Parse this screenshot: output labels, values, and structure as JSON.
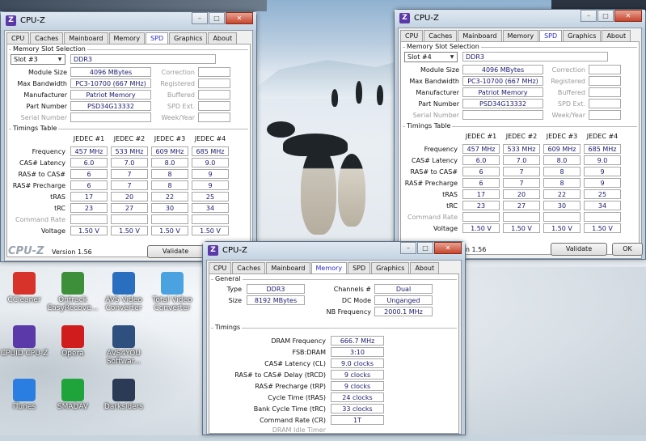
{
  "cpuz_left": {
    "title": "CPU-Z",
    "tabs": [
      "CPU",
      "Caches",
      "Mainboard",
      "Memory",
      "SPD",
      "Graphics",
      "About"
    ],
    "active_tab": "SPD",
    "memory_slot_selection": "Memory Slot Selection",
    "slot": "Slot #3",
    "type": "DDR3",
    "module_size_label": "Module Size",
    "module_size": "4096 MBytes",
    "max_bandwidth_label": "Max Bandwidth",
    "max_bandwidth": "PC3-10700 (667 MHz)",
    "manufacturer_label": "Manufacturer",
    "manufacturer": "Patriot Memory",
    "part_number_label": "Part Number",
    "part_number": "PSD34G13332",
    "serial_number_label": "Serial Number",
    "correction_label": "Correction",
    "registered_label": "Registered",
    "buffered_label": "Buffered",
    "spd_ext_label": "SPD Ext.",
    "week_year_label": "Week/Year",
    "timings_table_label": "Timings Table",
    "jedec_headers": [
      "JEDEC #1",
      "JEDEC #2",
      "JEDEC #3",
      "JEDEC #4"
    ],
    "rows": [
      {
        "label": "Frequency",
        "values": [
          "457 MHz",
          "533 MHz",
          "609 MHz",
          "685 MHz"
        ]
      },
      {
        "label": "CAS# Latency",
        "values": [
          "6.0",
          "7.0",
          "8.0",
          "9.0"
        ]
      },
      {
        "label": "RAS# to CAS#",
        "values": [
          "6",
          "7",
          "8",
          "9"
        ]
      },
      {
        "label": "RAS# Precharge",
        "values": [
          "6",
          "7",
          "8",
          "9"
        ]
      },
      {
        "label": "tRAS",
        "values": [
          "17",
          "20",
          "22",
          "25"
        ]
      },
      {
        "label": "tRC",
        "values": [
          "23",
          "27",
          "30",
          "34"
        ]
      },
      {
        "label": "Command Rate",
        "values": [
          "",
          "",
          "",
          ""
        ]
      },
      {
        "label": "Voltage",
        "values": [
          "1.50 V",
          "1.50 V",
          "1.50 V",
          "1.50 V"
        ]
      }
    ],
    "brand": "CPU-Z",
    "version": "Version 1.56",
    "validate": "Validate"
  },
  "cpuz_right": {
    "title": "CPU-Z",
    "tabs": [
      "CPU",
      "Caches",
      "Mainboard",
      "Memory",
      "SPD",
      "Graphics",
      "About"
    ],
    "active_tab": "SPD",
    "memory_slot_selection": "Memory Slot Selection",
    "slot": "Slot #4",
    "type": "DDR3",
    "module_size_label": "Module Size",
    "module_size": "4096 MBytes",
    "max_bandwidth_label": "Max Bandwidth",
    "max_bandwidth": "PC3-10700 (667 MHz)",
    "manufacturer_label": "Manufacturer",
    "manufacturer": "Patriot Memory",
    "part_number_label": "Part Number",
    "part_number": "PSD34G13332",
    "serial_number_label": "Serial Number",
    "correction_label": "Correction",
    "registered_label": "Registered",
    "buffered_label": "Buffered",
    "spd_ext_label": "SPD Ext.",
    "week_year_label": "Week/Year",
    "timings_table_label": "Timings Table",
    "jedec_headers": [
      "JEDEC #1",
      "JEDEC #2",
      "JEDEC #3",
      "JEDEC #4"
    ],
    "rows": [
      {
        "label": "Frequency",
        "values": [
          "457 MHz",
          "533 MHz",
          "609 MHz",
          "685 MHz"
        ]
      },
      {
        "label": "CAS# Latency",
        "values": [
          "6.0",
          "7.0",
          "8.0",
          "9.0"
        ]
      },
      {
        "label": "RAS# to CAS#",
        "values": [
          "6",
          "7",
          "8",
          "9"
        ]
      },
      {
        "label": "RAS# Precharge",
        "values": [
          "6",
          "7",
          "8",
          "9"
        ]
      },
      {
        "label": "tRAS",
        "values": [
          "17",
          "20",
          "22",
          "25"
        ]
      },
      {
        "label": "tRC",
        "values": [
          "23",
          "27",
          "30",
          "34"
        ]
      },
      {
        "label": "Command Rate",
        "values": [
          "",
          "",
          "",
          ""
        ]
      },
      {
        "label": "Voltage",
        "values": [
          "1.50 V",
          "1.50 V",
          "1.50 V",
          "1.50 V"
        ]
      }
    ],
    "version": "on 1.56",
    "validate": "Validate",
    "ok": "OK"
  },
  "cpuz_front": {
    "title": "CPU-Z",
    "tabs": [
      "CPU",
      "Caches",
      "Mainboard",
      "Memory",
      "SPD",
      "Graphics",
      "About"
    ],
    "active_tab": "Memory",
    "general_label": "General",
    "type_label": "Type",
    "type": "DDR3",
    "size_label": "Size",
    "size": "8192 MBytes",
    "channels_label": "Channels #",
    "channels": "Dual",
    "dc_mode_label": "DC Mode",
    "dc_mode": "Unganged",
    "nb_freq_label": "NB Frequency",
    "nb_freq": "2000.1 MHz",
    "timings_label": "Timings",
    "timings": [
      {
        "label": "DRAM Frequency",
        "value": "666.7 MHz"
      },
      {
        "label": "FSB:DRAM",
        "value": "3:10"
      },
      {
        "label": "CAS# Latency (CL)",
        "value": "9.0 clocks"
      },
      {
        "label": "RAS# to CAS# Delay (tRCD)",
        "value": "9 clocks"
      },
      {
        "label": "RAS# Precharge (tRP)",
        "value": "9 clocks"
      },
      {
        "label": "Cycle Time (tRAS)",
        "value": "24 clocks"
      },
      {
        "label": "Bank Cycle Time (tRC)",
        "value": "33 clocks"
      },
      {
        "label": "Command Rate (CR)",
        "value": "1T"
      }
    ],
    "dram_idle_label": "DRAM Idle Timer"
  },
  "desktop_icons": [
    {
      "label": "CCleaner",
      "icon": "ccleaner-icon",
      "color": "#d8332b"
    },
    {
      "label": "Ontrack EasyRecove...",
      "icon": "ontrack-icon",
      "color": "#3e8f3a"
    },
    {
      "label": "AVS Video Converter",
      "icon": "avs-video-icon",
      "color": "#2a6fbf"
    },
    {
      "label": "Total Video Converter",
      "icon": "total-video-icon",
      "color": "#4aa3e0"
    },
    {
      "label": "CPUID CPU-Z",
      "icon": "cpuz-icon",
      "color": "#5b39a8"
    },
    {
      "label": "Opera",
      "icon": "opera-icon",
      "color": "#d01c1c"
    },
    {
      "label": "AVS4YOU Softwar...",
      "icon": "avs4you-icon",
      "color": "#2f4f7f"
    },
    {
      "label": "iTunes",
      "icon": "itunes-icon",
      "color": "#2a7de1"
    },
    {
      "label": "SMADAV",
      "icon": "smadav-icon",
      "color": "#1fa43c"
    },
    {
      "label": "Darksiders",
      "icon": "darksiders-icon",
      "color": "#2b3a55"
    }
  ]
}
